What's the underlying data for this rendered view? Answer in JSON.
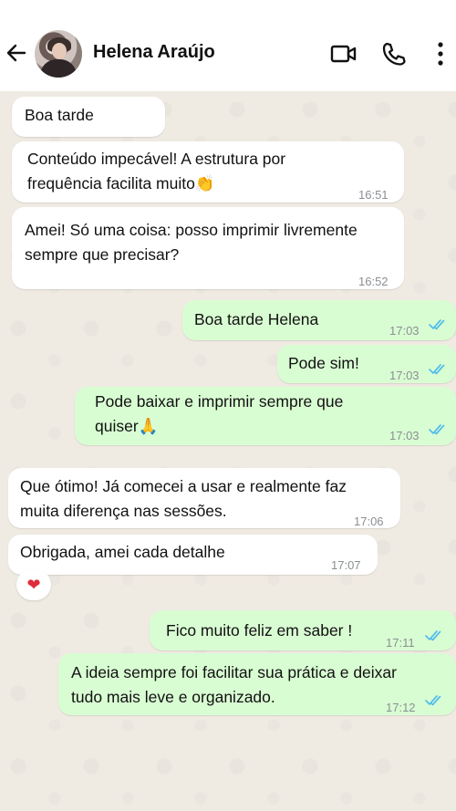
{
  "header": {
    "contact_name": "Helena Araújo",
    "icons": [
      "back-arrow-icon",
      "avatar",
      "video-call-icon",
      "phone-call-icon",
      "more-options-icon"
    ]
  },
  "colors": {
    "incoming_bubble": "#ffffff",
    "outgoing_bubble": "#d9fdd3",
    "read_ticks": "#53bdeb",
    "chat_background": "#efeae2"
  },
  "messages": [
    {
      "dir": "in",
      "text": "Boa tarde",
      "time": ""
    },
    {
      "dir": "in",
      "text": "Conteúdo impecável! A estrutura por\nfrequência facilita muito👏",
      "time": "16:51"
    },
    {
      "dir": "in",
      "text": "Amei! Só uma coisa: posso imprimir livremente\nsempre que precisar?",
      "time": "16:52"
    },
    {
      "dir": "out",
      "text": "Boa tarde Helena",
      "time": "17:03",
      "status": "read"
    },
    {
      "dir": "out",
      "text": "Pode sim!",
      "time": "17:03",
      "status": "read"
    },
    {
      "dir": "out",
      "text": "Pode baixar e imprimir sempre que\nquiser🙏",
      "time": "17:03",
      "status": "read"
    },
    {
      "dir": "in",
      "text": "Que ótimo! Já comecei a usar e realmente faz\nmuita diferença nas sessões.",
      "time": "17:06"
    },
    {
      "dir": "in",
      "text": "Obrigada, amei cada detalhe",
      "time": "17:07",
      "reaction": "❤"
    },
    {
      "dir": "out",
      "text": "Fico muito feliz em saber !",
      "time": "17:11",
      "status": "read"
    },
    {
      "dir": "out",
      "text": "A ideia sempre foi facilitar sua prática e deixar\ntudo mais leve e organizado.",
      "time": "17:12",
      "status": "read"
    }
  ]
}
